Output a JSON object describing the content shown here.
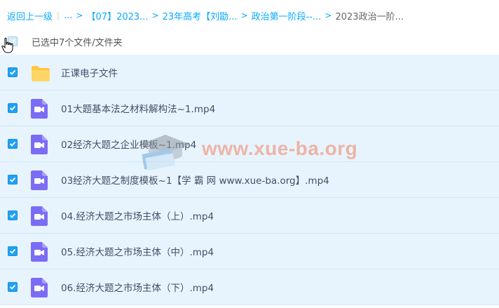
{
  "breadcrumb": {
    "back": "返回上一级",
    "ellipsis": "...",
    "items": [
      "【07】2023...",
      "23年高考【刘勖...",
      "政治第一阶段--...",
      "2023政治一阶..."
    ]
  },
  "selection": {
    "text": "已选中7个文件/文件夹"
  },
  "files": [
    {
      "name": "正课电子文件",
      "type": "folder"
    },
    {
      "name": "01大题基本法之材料解构法~1.mp4",
      "type": "video"
    },
    {
      "name": "02经济大题之企业模板~1.mp4",
      "type": "video"
    },
    {
      "name": "03经济大题之制度模板~1【学 霸 网 www.xue-ba.org】.mp4",
      "type": "video"
    },
    {
      "name": "04.经济大题之市场主体（上）.mp4",
      "type": "video"
    },
    {
      "name": "05.经济大题之市场主体（中）.mp4",
      "type": "video"
    },
    {
      "name": "06.经济大题之市场主体（下）.mp4",
      "type": "video"
    }
  ],
  "watermark": {
    "text": "www.xue-ba.org"
  },
  "colors": {
    "accent": "#09aaff",
    "row_bg": "#e8f4fd",
    "folder": "#ffc53d",
    "video": "#7b6cf6"
  }
}
